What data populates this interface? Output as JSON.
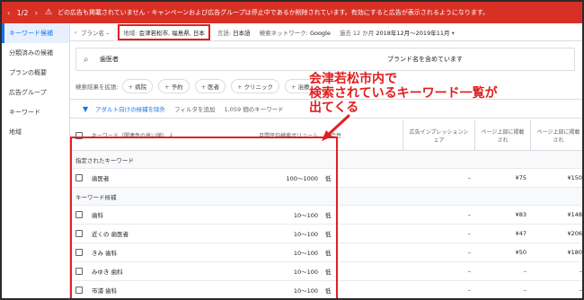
{
  "banner": {
    "pager": "1/2",
    "prev": "‹",
    "next": "›",
    "message": "どの広告も掲載されていません - キャンペーンおよび広告グループは停止中であるか削除されています。有効にすると広告が表示されるようになります。"
  },
  "sidebar": {
    "items": [
      {
        "label": "キーワード候補"
      },
      {
        "label": "分類済みの候補"
      },
      {
        "label": "プランの概要"
      },
      {
        "label": "広告グループ"
      },
      {
        "label": "キーワード"
      },
      {
        "label": "地域"
      }
    ]
  },
  "filterbar": {
    "plan_label": "プラン名",
    "plan_value": "–",
    "location_label": "地域:",
    "location_value": "会津若松市, 福島県, 日本",
    "language_label": "言語:",
    "language_value": "日本語",
    "network_label": "検索ネットワーク:",
    "network_value": "Google",
    "period_label": "過去 12 か月",
    "period_value": "2018年12月〜2019年11月"
  },
  "search": {
    "query": "歯医者",
    "brand": "ブランド名を含めています"
  },
  "chips": {
    "label": "検索結果を拡張:",
    "items": [
      "病院",
      "予約",
      "医者",
      "クリニック",
      "治療"
    ]
  },
  "toolbar": {
    "exclude": "アダルト向けの候補を除外",
    "add_filter": "フィルタを追加",
    "count": "1,059 個のキーワード"
  },
  "table": {
    "headers": {
      "keyword": "キーワード（関連性の高い順）",
      "volume": "月間平均検索ボリューム",
      "competition": "競合性",
      "impression_share": "広告インプレッションシェア",
      "bid_low": "ページ上部に掲載され",
      "bid_high": "ページ上部に掲載され"
    },
    "group_provided": "指定されたキーワード",
    "group_ideas": "キーワード候補",
    "provided_rows": [
      {
        "keyword": "歯医者",
        "volume": "100〜1000",
        "competition": "低",
        "share": "–",
        "low": "¥75",
        "high": "¥150"
      }
    ],
    "idea_rows": [
      {
        "keyword": "歯科",
        "volume": "10〜100",
        "competition": "低",
        "share": "–",
        "low": "¥83",
        "high": "¥148"
      },
      {
        "keyword": "近くの 歯医者",
        "volume": "10〜100",
        "competition": "低",
        "share": "–",
        "low": "¥47",
        "high": "¥206"
      },
      {
        "keyword": "きみ 歯科",
        "volume": "10〜100",
        "competition": "低",
        "share": "–",
        "low": "¥50",
        "high": "¥180"
      },
      {
        "keyword": "みゆき 歯科",
        "volume": "10〜100",
        "competition": "低",
        "share": "–",
        "low": "–",
        "high": "–"
      },
      {
        "keyword": "市浦 歯科",
        "volume": "10〜100",
        "competition": "低",
        "share": "–",
        "low": "–",
        "high": "–"
      }
    ]
  },
  "annotation": {
    "line1": "会津若松市内で",
    "line2": "検索されているキーワード一覧が",
    "line3": "出てくる"
  },
  "colors": {
    "banner": "#d93025",
    "accent": "#1a73e8",
    "highlight": "#e02020"
  }
}
